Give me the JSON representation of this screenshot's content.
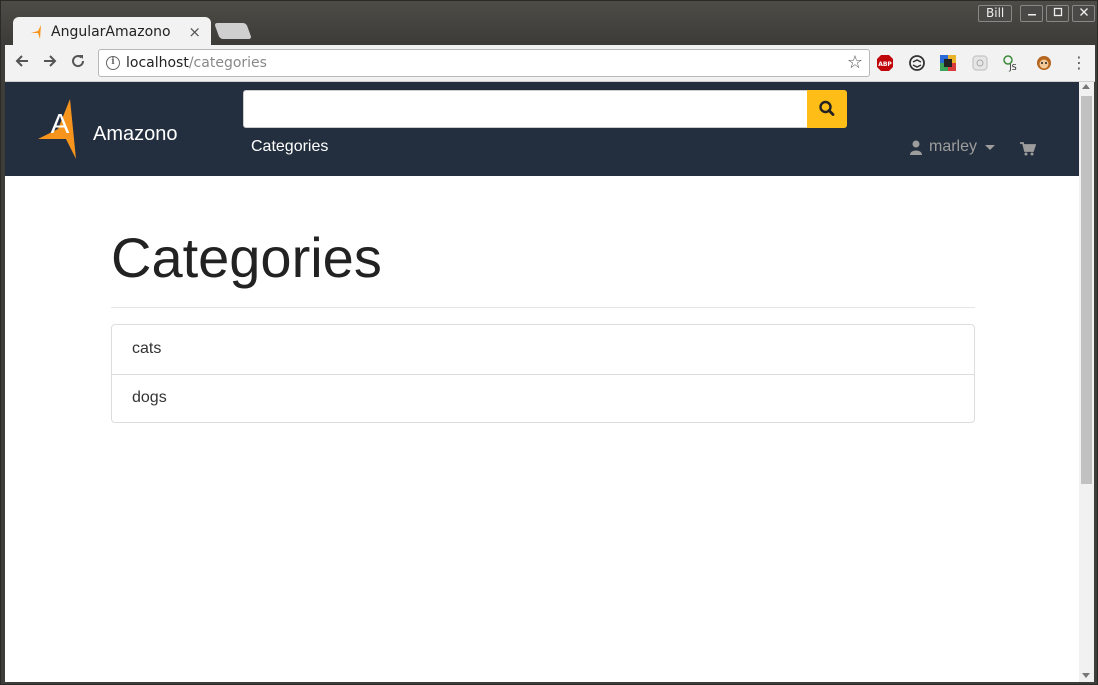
{
  "browser": {
    "tab_title": "AngularAmazono",
    "tab_close": "×",
    "user": "Bill",
    "url_host": "localhost",
    "url_path": "/categories",
    "extensions": [
      "adblock-icon",
      "sync-icon",
      "color-picker-icon",
      "puzzle-icon",
      "js-icon",
      "monkey-icon"
    ]
  },
  "navbar": {
    "brand": "Amazono",
    "search_placeholder": "",
    "categories_link": "Categories",
    "user_name": "marley"
  },
  "page": {
    "title": "Categories",
    "categories": [
      "cats",
      "dogs"
    ]
  },
  "colors": {
    "navbar_bg": "#232f3e",
    "search_button": "#febd17",
    "brand_logo": "#f7941d"
  }
}
